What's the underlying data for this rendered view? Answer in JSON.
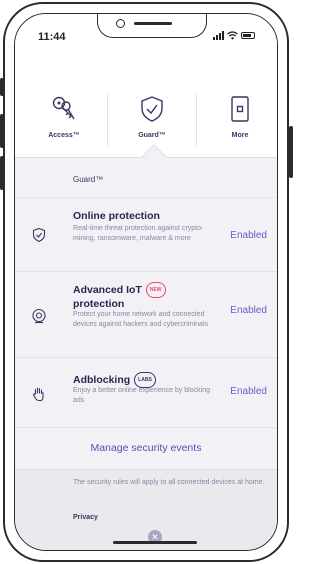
{
  "status_bar": {
    "time": "11:44"
  },
  "top_nav": {
    "items": [
      {
        "label": "Access™",
        "icon": "keys-icon"
      },
      {
        "label": "Guard™",
        "icon": "shield-check-icon",
        "selected": true
      },
      {
        "label": "More",
        "icon": "device-icon"
      }
    ]
  },
  "section": {
    "title": "Guard™"
  },
  "features": [
    {
      "title": "Online protection",
      "badge": "",
      "description": "Real-time threat protection against crypto-mining, ransomware, malware & more",
      "status": "Enabled",
      "icon": "shield-check-icon"
    },
    {
      "title": "Advanced IoT protection",
      "title_line1": "Advanced IoT",
      "title_line2": "protection",
      "badge": "NEW",
      "description": "Protect your home network and connected devices against hackers and cybercriminals",
      "status": "Enabled",
      "icon": "camera-icon"
    },
    {
      "title": "Adblocking",
      "badge": "LABS",
      "description": "Enjoy a better online experience by blocking ads",
      "status": "Enabled",
      "icon": "hand-stop-icon"
    }
  ],
  "manage": {
    "label": "Manage security events"
  },
  "footer": {
    "note": "The security rules will apply to all connected devices at home.",
    "privacy": "Privacy",
    "close_icon": "close-icon"
  },
  "colors": {
    "accent": "#6a5dc8",
    "title_text": "#2a2550",
    "muted_text": "#8a86a0",
    "badge_new": "#e84a6a",
    "background": "#f3f1f5"
  }
}
